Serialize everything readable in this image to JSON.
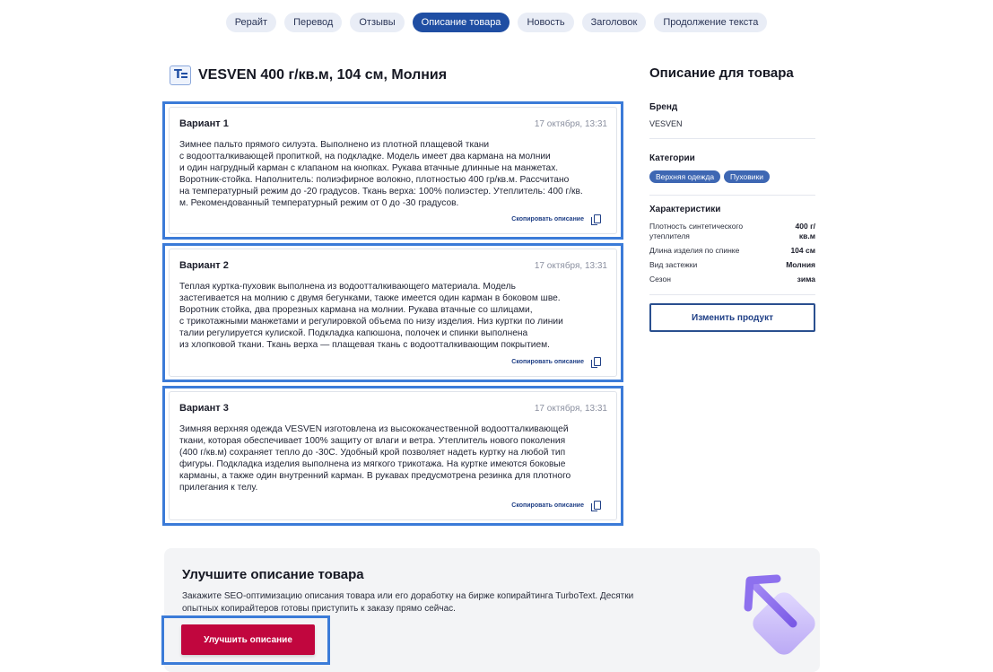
{
  "tabs": [
    {
      "label": "Рерайт",
      "active": false
    },
    {
      "label": "Перевод",
      "active": false
    },
    {
      "label": "Отзывы",
      "active": false
    },
    {
      "label": "Описание товара",
      "active": true
    },
    {
      "label": "Новость",
      "active": false
    },
    {
      "label": "Заголовок",
      "active": false
    },
    {
      "label": "Продолжение текста",
      "active": false
    }
  ],
  "product": {
    "title": "VESVEN 400 г/кв.м, 104 см, Молния",
    "icon": "document-text-icon"
  },
  "variants": [
    {
      "title": "Вариант 1",
      "date": "17 октября, 13:31",
      "text": "Зимнее пальто прямого силуэта. Выполнено из плотной плащевой ткани\nс водоотталкивающей пропиткой, на подкладке. Модель имеет два кармана на молнии\nи один нагрудный карман с клапаном на кнопках. Рукава втачные длинные на манжетах.\nВоротник-стойка. Наполнитель: полиэфирное волокно, плотностью 400 гр/кв.м. Рассчитано\nна температурный режим до -20 градусов. Ткань верха: 100% полиэстер. Утеплитель: 400 г/кв.\nм. Рекомендованный температурный режим от 0 до -30 градусов.",
      "copy_label": "Скопировать описание"
    },
    {
      "title": "Вариант 2",
      "date": "17 октября, 13:31",
      "text": "Теплая куртка-пуховик выполнена из водоотталкивающего материала. Модель\nзастегивается на молнию с двумя бегунками, также имеется один карман в боковом шве.\nВоротник стойка, два прорезных кармана на молнии. Рукава втачные со шлицами,\nс трикотажными манжетами и регулировкой объема по низу изделия. Низ куртки по линии\nталии регулируется кулиской. Подкладка капюшона, полочек и спинки выполнена\nиз хлопковой ткани. Ткань верха — плащевая ткань с водоотталкивающим покрытием.",
      "copy_label": "Скопировать описание"
    },
    {
      "title": "Вариант 3",
      "date": "17 октября, 13:31",
      "text": "Зимняя верхняя одежда VESVEN изготовлена из высококачественной водоотталкивающей\nткани, которая обеспечивает 100% защиту от влаги и ветра. Утеплитель нового поколения\n(400 г/кв.м) сохраняет тепло до -30С. Удобный крой позволяет надеть куртку на любой тип\nфигуры. Подкладка изделия выполнена из мягкого трикотажа. На куртке имеются боковые\nкарманы, а также один внутренний карман. В рукавах предусмотрена резинка для плотного\nприлегания к телу.",
      "copy_label": "Скопировать описание"
    }
  ],
  "sidebar": {
    "title": "Описание для товара",
    "brand_label": "Бренд",
    "brand_value": "VESVEN",
    "categories_label": "Категории",
    "categories": [
      "Верхняя одежда",
      "Пуховики"
    ],
    "specs_label": "Характеристики",
    "specs": [
      {
        "name": "Плотность синтетического утеплителя",
        "value": "400 г/кв.м"
      },
      {
        "name": "Длина изделия по спинке",
        "value": "104 см"
      },
      {
        "name": "Вид застежки",
        "value": "Молния"
      },
      {
        "name": "Сезон",
        "value": "зима"
      }
    ],
    "edit_button": "Изменить продукт"
  },
  "promo": {
    "title": "Улучшите описание товара",
    "text": "Закажите SEO-оптимизацию описания товара или его доработку на бирже копирайтинга TurboText. Десятки\nопытных копирайтеров готовы приступить к заказу прямо сейчас.",
    "button": "Улучшить описание"
  },
  "colors": {
    "accent": "#1f4ea3",
    "highlight_frame": "#3b7bd8",
    "cta": "#c1063e",
    "chip": "#3e67b3"
  }
}
